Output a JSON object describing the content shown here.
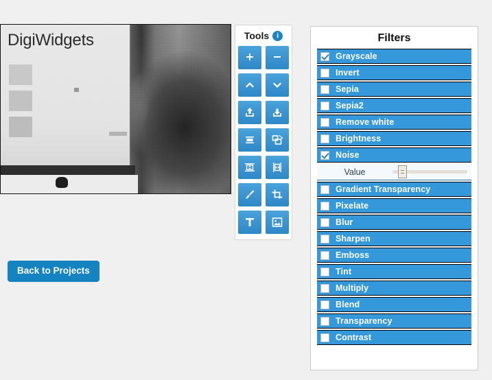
{
  "canvas": {
    "image_title_text": "DigiWidgets",
    "alt": "grayscale noisy photo of a person pointing at a computer monitor"
  },
  "back_button": {
    "label": "Back to Projects"
  },
  "tools": {
    "title": "Tools",
    "info_badge": "i",
    "buttons": [
      {
        "name": "zoom-in",
        "icon": "plus-icon"
      },
      {
        "name": "zoom-out",
        "icon": "minus-icon"
      },
      {
        "name": "move-up",
        "icon": "chevron-up-icon"
      },
      {
        "name": "move-down",
        "icon": "chevron-down-icon"
      },
      {
        "name": "upload-image",
        "icon": "upload-icon"
      },
      {
        "name": "download-image",
        "icon": "download-icon"
      },
      {
        "name": "resize-canvas",
        "icon": "resize-icon"
      },
      {
        "name": "rotate-image",
        "icon": "rotate-icon"
      },
      {
        "name": "flip-vertical",
        "icon": "flip-vertical-icon"
      },
      {
        "name": "flip-horizontal",
        "icon": "flip-horizontal-icon"
      },
      {
        "name": "brush-tool",
        "icon": "paintbrush-icon"
      },
      {
        "name": "crop-tool",
        "icon": "crop-icon"
      },
      {
        "name": "text-tool",
        "icon": "text-t-icon"
      },
      {
        "name": "insert-image",
        "icon": "picture-icon"
      }
    ]
  },
  "filters": {
    "title": "Filters",
    "items": [
      {
        "label": "Grayscale",
        "checked": true
      },
      {
        "label": "Invert",
        "checked": false
      },
      {
        "label": "Sepia",
        "checked": false
      },
      {
        "label": "Sepia2",
        "checked": false
      },
      {
        "label": "Remove white",
        "checked": false
      },
      {
        "label": "Brightness",
        "checked": false
      },
      {
        "label": "Noise",
        "checked": true
      },
      {
        "label": "Gradient Transparency",
        "checked": false
      },
      {
        "label": "Pixelate",
        "checked": false
      },
      {
        "label": "Blur",
        "checked": false
      },
      {
        "label": "Sharpen",
        "checked": false
      },
      {
        "label": "Emboss",
        "checked": false
      },
      {
        "label": "Tint",
        "checked": false
      },
      {
        "label": "Multiply",
        "checked": false
      },
      {
        "label": "Blend",
        "checked": false
      },
      {
        "label": "Transparency",
        "checked": false
      },
      {
        "label": "Contrast",
        "checked": false
      }
    ],
    "slider": {
      "after_item": "Noise",
      "label": "Value",
      "position_percent": 13
    }
  },
  "colors": {
    "accent_blue": "#3498db",
    "button_blue": "#1583c0",
    "tool_blue": "#3d94cf",
    "page_background": "#f0f0f0"
  }
}
